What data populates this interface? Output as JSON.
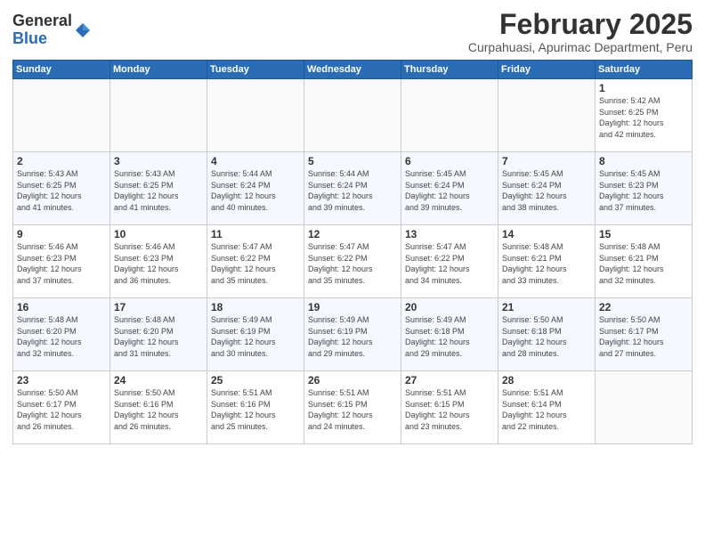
{
  "logo": {
    "general": "General",
    "blue": "Blue"
  },
  "header": {
    "month": "February 2025",
    "location": "Curpahuasi, Apurimac Department, Peru"
  },
  "weekdays": [
    "Sunday",
    "Monday",
    "Tuesday",
    "Wednesday",
    "Thursday",
    "Friday",
    "Saturday"
  ],
  "weeks": [
    [
      {
        "day": "",
        "info": ""
      },
      {
        "day": "",
        "info": ""
      },
      {
        "day": "",
        "info": ""
      },
      {
        "day": "",
        "info": ""
      },
      {
        "day": "",
        "info": ""
      },
      {
        "day": "",
        "info": ""
      },
      {
        "day": "1",
        "info": "Sunrise: 5:42 AM\nSunset: 6:25 PM\nDaylight: 12 hours\nand 42 minutes."
      }
    ],
    [
      {
        "day": "2",
        "info": "Sunrise: 5:43 AM\nSunset: 6:25 PM\nDaylight: 12 hours\nand 41 minutes."
      },
      {
        "day": "3",
        "info": "Sunrise: 5:43 AM\nSunset: 6:25 PM\nDaylight: 12 hours\nand 41 minutes."
      },
      {
        "day": "4",
        "info": "Sunrise: 5:44 AM\nSunset: 6:24 PM\nDaylight: 12 hours\nand 40 minutes."
      },
      {
        "day": "5",
        "info": "Sunrise: 5:44 AM\nSunset: 6:24 PM\nDaylight: 12 hours\nand 39 minutes."
      },
      {
        "day": "6",
        "info": "Sunrise: 5:45 AM\nSunset: 6:24 PM\nDaylight: 12 hours\nand 39 minutes."
      },
      {
        "day": "7",
        "info": "Sunrise: 5:45 AM\nSunset: 6:24 PM\nDaylight: 12 hours\nand 38 minutes."
      },
      {
        "day": "8",
        "info": "Sunrise: 5:45 AM\nSunset: 6:23 PM\nDaylight: 12 hours\nand 37 minutes."
      }
    ],
    [
      {
        "day": "9",
        "info": "Sunrise: 5:46 AM\nSunset: 6:23 PM\nDaylight: 12 hours\nand 37 minutes."
      },
      {
        "day": "10",
        "info": "Sunrise: 5:46 AM\nSunset: 6:23 PM\nDaylight: 12 hours\nand 36 minutes."
      },
      {
        "day": "11",
        "info": "Sunrise: 5:47 AM\nSunset: 6:22 PM\nDaylight: 12 hours\nand 35 minutes."
      },
      {
        "day": "12",
        "info": "Sunrise: 5:47 AM\nSunset: 6:22 PM\nDaylight: 12 hours\nand 35 minutes."
      },
      {
        "day": "13",
        "info": "Sunrise: 5:47 AM\nSunset: 6:22 PM\nDaylight: 12 hours\nand 34 minutes."
      },
      {
        "day": "14",
        "info": "Sunrise: 5:48 AM\nSunset: 6:21 PM\nDaylight: 12 hours\nand 33 minutes."
      },
      {
        "day": "15",
        "info": "Sunrise: 5:48 AM\nSunset: 6:21 PM\nDaylight: 12 hours\nand 32 minutes."
      }
    ],
    [
      {
        "day": "16",
        "info": "Sunrise: 5:48 AM\nSunset: 6:20 PM\nDaylight: 12 hours\nand 32 minutes."
      },
      {
        "day": "17",
        "info": "Sunrise: 5:48 AM\nSunset: 6:20 PM\nDaylight: 12 hours\nand 31 minutes."
      },
      {
        "day": "18",
        "info": "Sunrise: 5:49 AM\nSunset: 6:19 PM\nDaylight: 12 hours\nand 30 minutes."
      },
      {
        "day": "19",
        "info": "Sunrise: 5:49 AM\nSunset: 6:19 PM\nDaylight: 12 hours\nand 29 minutes."
      },
      {
        "day": "20",
        "info": "Sunrise: 5:49 AM\nSunset: 6:18 PM\nDaylight: 12 hours\nand 29 minutes."
      },
      {
        "day": "21",
        "info": "Sunrise: 5:50 AM\nSunset: 6:18 PM\nDaylight: 12 hours\nand 28 minutes."
      },
      {
        "day": "22",
        "info": "Sunrise: 5:50 AM\nSunset: 6:17 PM\nDaylight: 12 hours\nand 27 minutes."
      }
    ],
    [
      {
        "day": "23",
        "info": "Sunrise: 5:50 AM\nSunset: 6:17 PM\nDaylight: 12 hours\nand 26 minutes."
      },
      {
        "day": "24",
        "info": "Sunrise: 5:50 AM\nSunset: 6:16 PM\nDaylight: 12 hours\nand 26 minutes."
      },
      {
        "day": "25",
        "info": "Sunrise: 5:51 AM\nSunset: 6:16 PM\nDaylight: 12 hours\nand 25 minutes."
      },
      {
        "day": "26",
        "info": "Sunrise: 5:51 AM\nSunset: 6:15 PM\nDaylight: 12 hours\nand 24 minutes."
      },
      {
        "day": "27",
        "info": "Sunrise: 5:51 AM\nSunset: 6:15 PM\nDaylight: 12 hours\nand 23 minutes."
      },
      {
        "day": "28",
        "info": "Sunrise: 5:51 AM\nSunset: 6:14 PM\nDaylight: 12 hours\nand 22 minutes."
      },
      {
        "day": "",
        "info": ""
      }
    ]
  ]
}
